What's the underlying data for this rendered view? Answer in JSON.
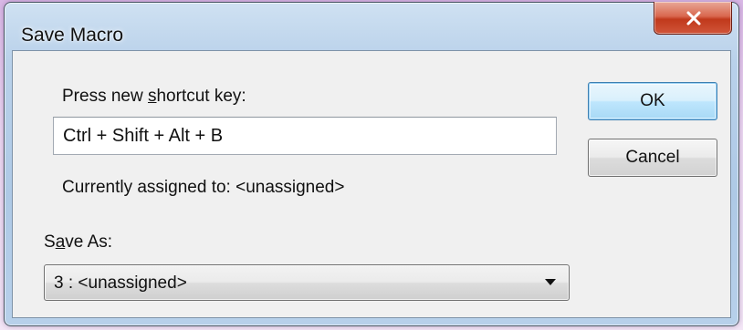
{
  "window": {
    "title": "Save Macro"
  },
  "shortcut": {
    "label_before": "Press new ",
    "label_mnemonic": "s",
    "label_after": "hortcut key:",
    "value": "Ctrl + Shift + Alt + B",
    "assigned_text": "Currently assigned to: <unassigned>"
  },
  "buttons": {
    "ok_label": "OK",
    "cancel_label": "Cancel"
  },
  "save_as": {
    "label_before": "S",
    "label_mnemonic": "a",
    "label_after": "ve As:",
    "selected": "3 : <unassigned>"
  },
  "icons": {
    "close": "close-icon",
    "dropdown": "chevron-down-icon"
  },
  "colors": {
    "close_button": "#c1391b",
    "default_button_border": "#3c7fb1",
    "dialog_background": "#f0f0f0"
  }
}
